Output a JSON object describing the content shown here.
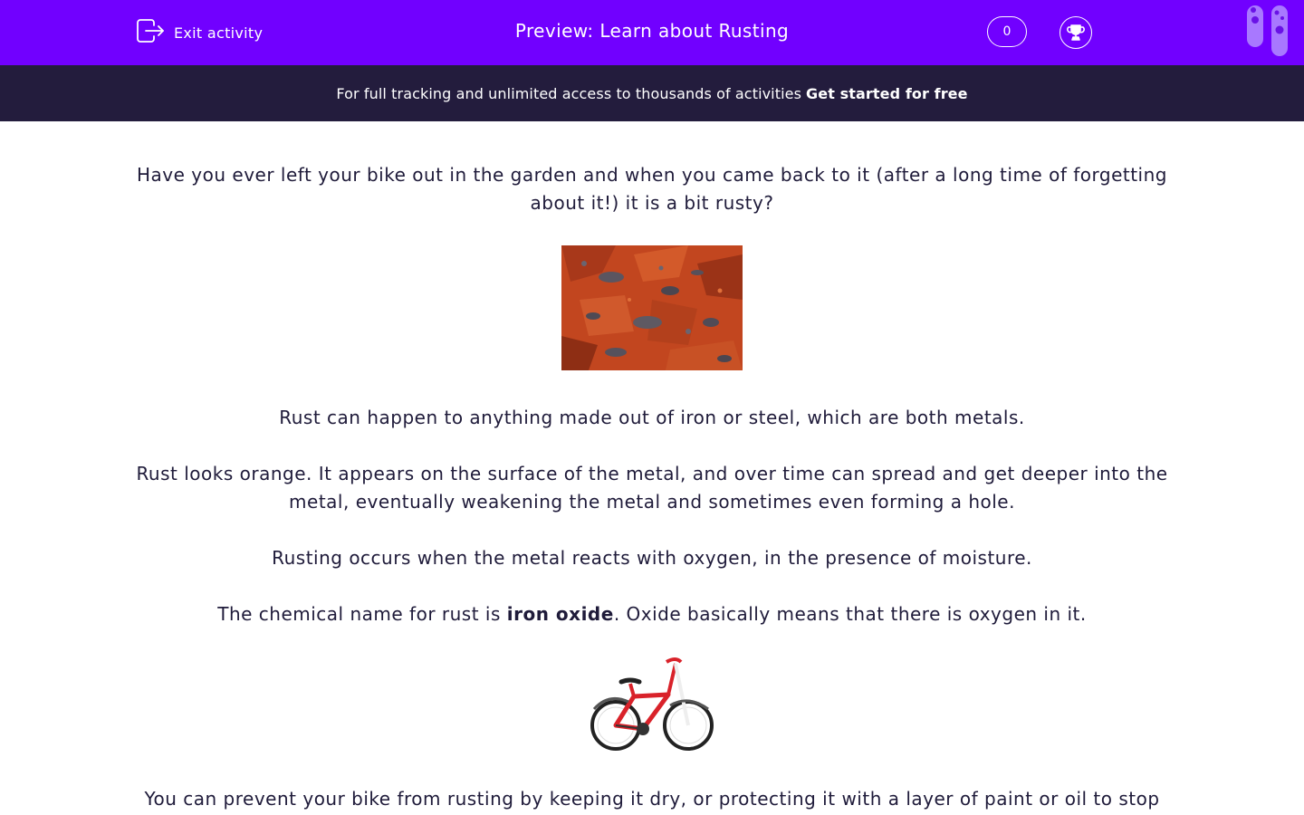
{
  "header": {
    "exit_label": "Exit activity",
    "title": "Preview: Learn about Rusting",
    "score": "0",
    "icons": [
      "exit-icon",
      "trophy-icon",
      "test-tubes-icon"
    ],
    "accent_color": "#7100ff"
  },
  "banner": {
    "text": "For full tracking and unlimited access to thousands of activities",
    "cta": "Get started for free",
    "background_color": "#231c3d"
  },
  "content": {
    "intro": "Have you ever left your bike out in the garden and when you came back to it (after a long time of forgetting about it!) it is a bit rusty?",
    "p1": "Rust can happen to anything made out of iron or steel, which are both metals.",
    "p2": "Rust looks orange. It appears on the surface of the metal, and over time can spread and get deeper into the metal, eventually weakening the metal and sometimes even forming a hole.",
    "p3": "Rusting occurs when the metal reacts with oxygen, in the presence of moisture.",
    "p4_before": "The chemical name for rust is ",
    "p4_bold": "iron oxide",
    "p4_after": ".  Oxide basically means that there is oxygen in it.",
    "p5": "You can prevent your bike from rusting by keeping it dry, or protecting it with a layer of paint or oil to stop",
    "images": [
      "rusty-metal-image",
      "red-bike-image"
    ]
  }
}
